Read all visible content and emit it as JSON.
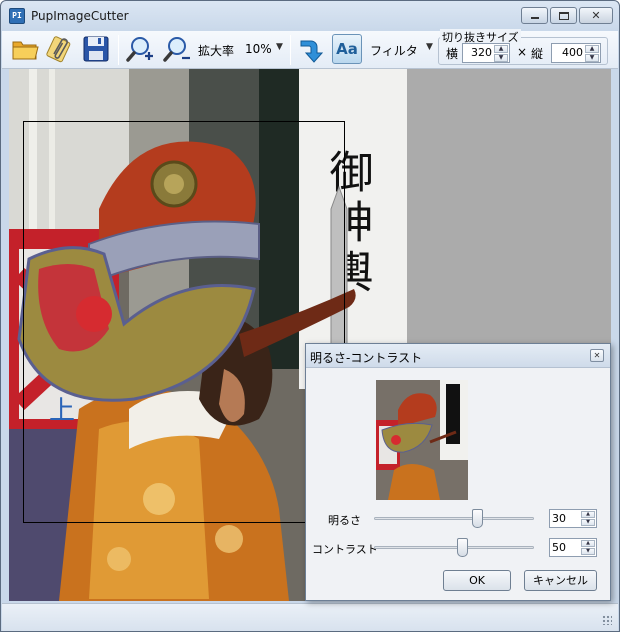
{
  "window": {
    "title": "PupImageCutter",
    "app_icon_text": "PI"
  },
  "toolbar": {
    "zoom_label": "拡大率",
    "zoom_value": "10%",
    "filter_label": "フィルタ",
    "font_icon_text": "Aa",
    "crop_size": {
      "legend": "切り抜きサイズ",
      "width_label": "横",
      "width_value": "320",
      "times": "×",
      "height_label": "縦",
      "height_value": "400"
    }
  },
  "dialog": {
    "title": "明るさ-コントラスト",
    "brightness_label": "明るさ",
    "brightness_value": "30",
    "contrast_label": "コントラスト",
    "contrast_value": "50",
    "ok_label": "OK",
    "cancel_label": "キャンセル"
  },
  "photo": {
    "banner_text": "御神輿",
    "sign_text": "上"
  },
  "colors": {
    "workarea_bg": "#ababab",
    "toolbar_bg": "#e4ecf6",
    "dialog_bg": "#f0f2f5"
  }
}
